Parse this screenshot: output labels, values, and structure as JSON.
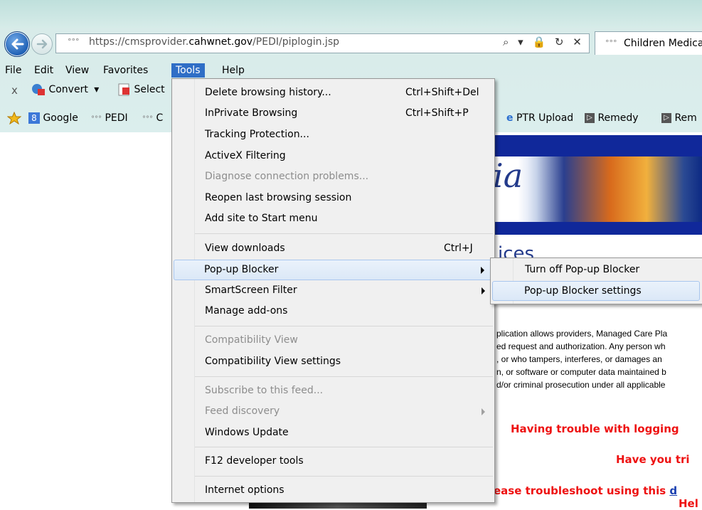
{
  "address": {
    "prefix": "°°°",
    "url_start": "https://cmsprovider.",
    "url_domain": "cahwnet.gov",
    "url_path": "/PEDI/piplogin.jsp",
    "icons": "⌕ ▾ 🔒 ↻ ✕"
  },
  "tab": {
    "prefix": "°°°",
    "title": "Children Medica"
  },
  "menubar": {
    "file": "File",
    "edit": "Edit",
    "view": "View",
    "favorites": "Favorites",
    "tools": "Tools",
    "help": "Help"
  },
  "commandbar": {
    "close": "x",
    "convert": "Convert",
    "convert_arrow": "▾",
    "select": "Select"
  },
  "favorites": [
    {
      "label": "Google"
    },
    {
      "label": "PEDI"
    },
    {
      "label": "C"
    },
    {
      "label": "PTR Upload"
    },
    {
      "label": "Remedy"
    },
    {
      "label": "Rem"
    }
  ],
  "page": {
    "banner_word": "ia",
    "heading_fragment": "ices",
    "disclaimer": [
      "plication allows providers, Managed Care Pla",
      "ed request and authorization. Any person wh",
      ", or who tampers, interferes, or damages an",
      "n, or software or computer data maintained b",
      "d/or criminal prosecution under all applicable"
    ],
    "trouble_logging": "Having trouble with logging",
    "have_you_tried": "Have you tri",
    "troubleshoot_before": "ease troubleshoot using this ",
    "troubleshoot_link": "d",
    "help_text": "Hel"
  },
  "tools_menu": {
    "items": [
      {
        "label": "Delete browsing history...",
        "shortcut": "Ctrl+Shift+Del"
      },
      {
        "label": "InPrivate Browsing",
        "shortcut": "Ctrl+Shift+P"
      },
      {
        "label": "Tracking Protection..."
      },
      {
        "label": "ActiveX Filtering"
      },
      {
        "label": "Diagnose connection problems...",
        "disabled": true
      },
      {
        "label": "Reopen last browsing session"
      },
      {
        "label": "Add site to Start menu"
      },
      {
        "label": "View downloads",
        "shortcut": "Ctrl+J"
      },
      {
        "label": "Pop-up Blocker",
        "submenu": true,
        "highlighted": true
      },
      {
        "label": "SmartScreen Filter",
        "submenu": true
      },
      {
        "label": "Manage add-ons"
      },
      {
        "label": "Compatibility View",
        "disabled": true
      },
      {
        "label": "Compatibility View settings"
      },
      {
        "label": "Subscribe to this feed...",
        "disabled": true
      },
      {
        "label": "Feed discovery",
        "disabled": true,
        "submenu": true
      },
      {
        "label": "Windows Update"
      },
      {
        "label": "F12 developer tools"
      },
      {
        "label": "Internet options"
      }
    ]
  },
  "popup_submenu": {
    "items": [
      {
        "label": "Turn off Pop-up Blocker"
      },
      {
        "label": "Pop-up Blocker settings",
        "highlighted": true
      }
    ]
  }
}
